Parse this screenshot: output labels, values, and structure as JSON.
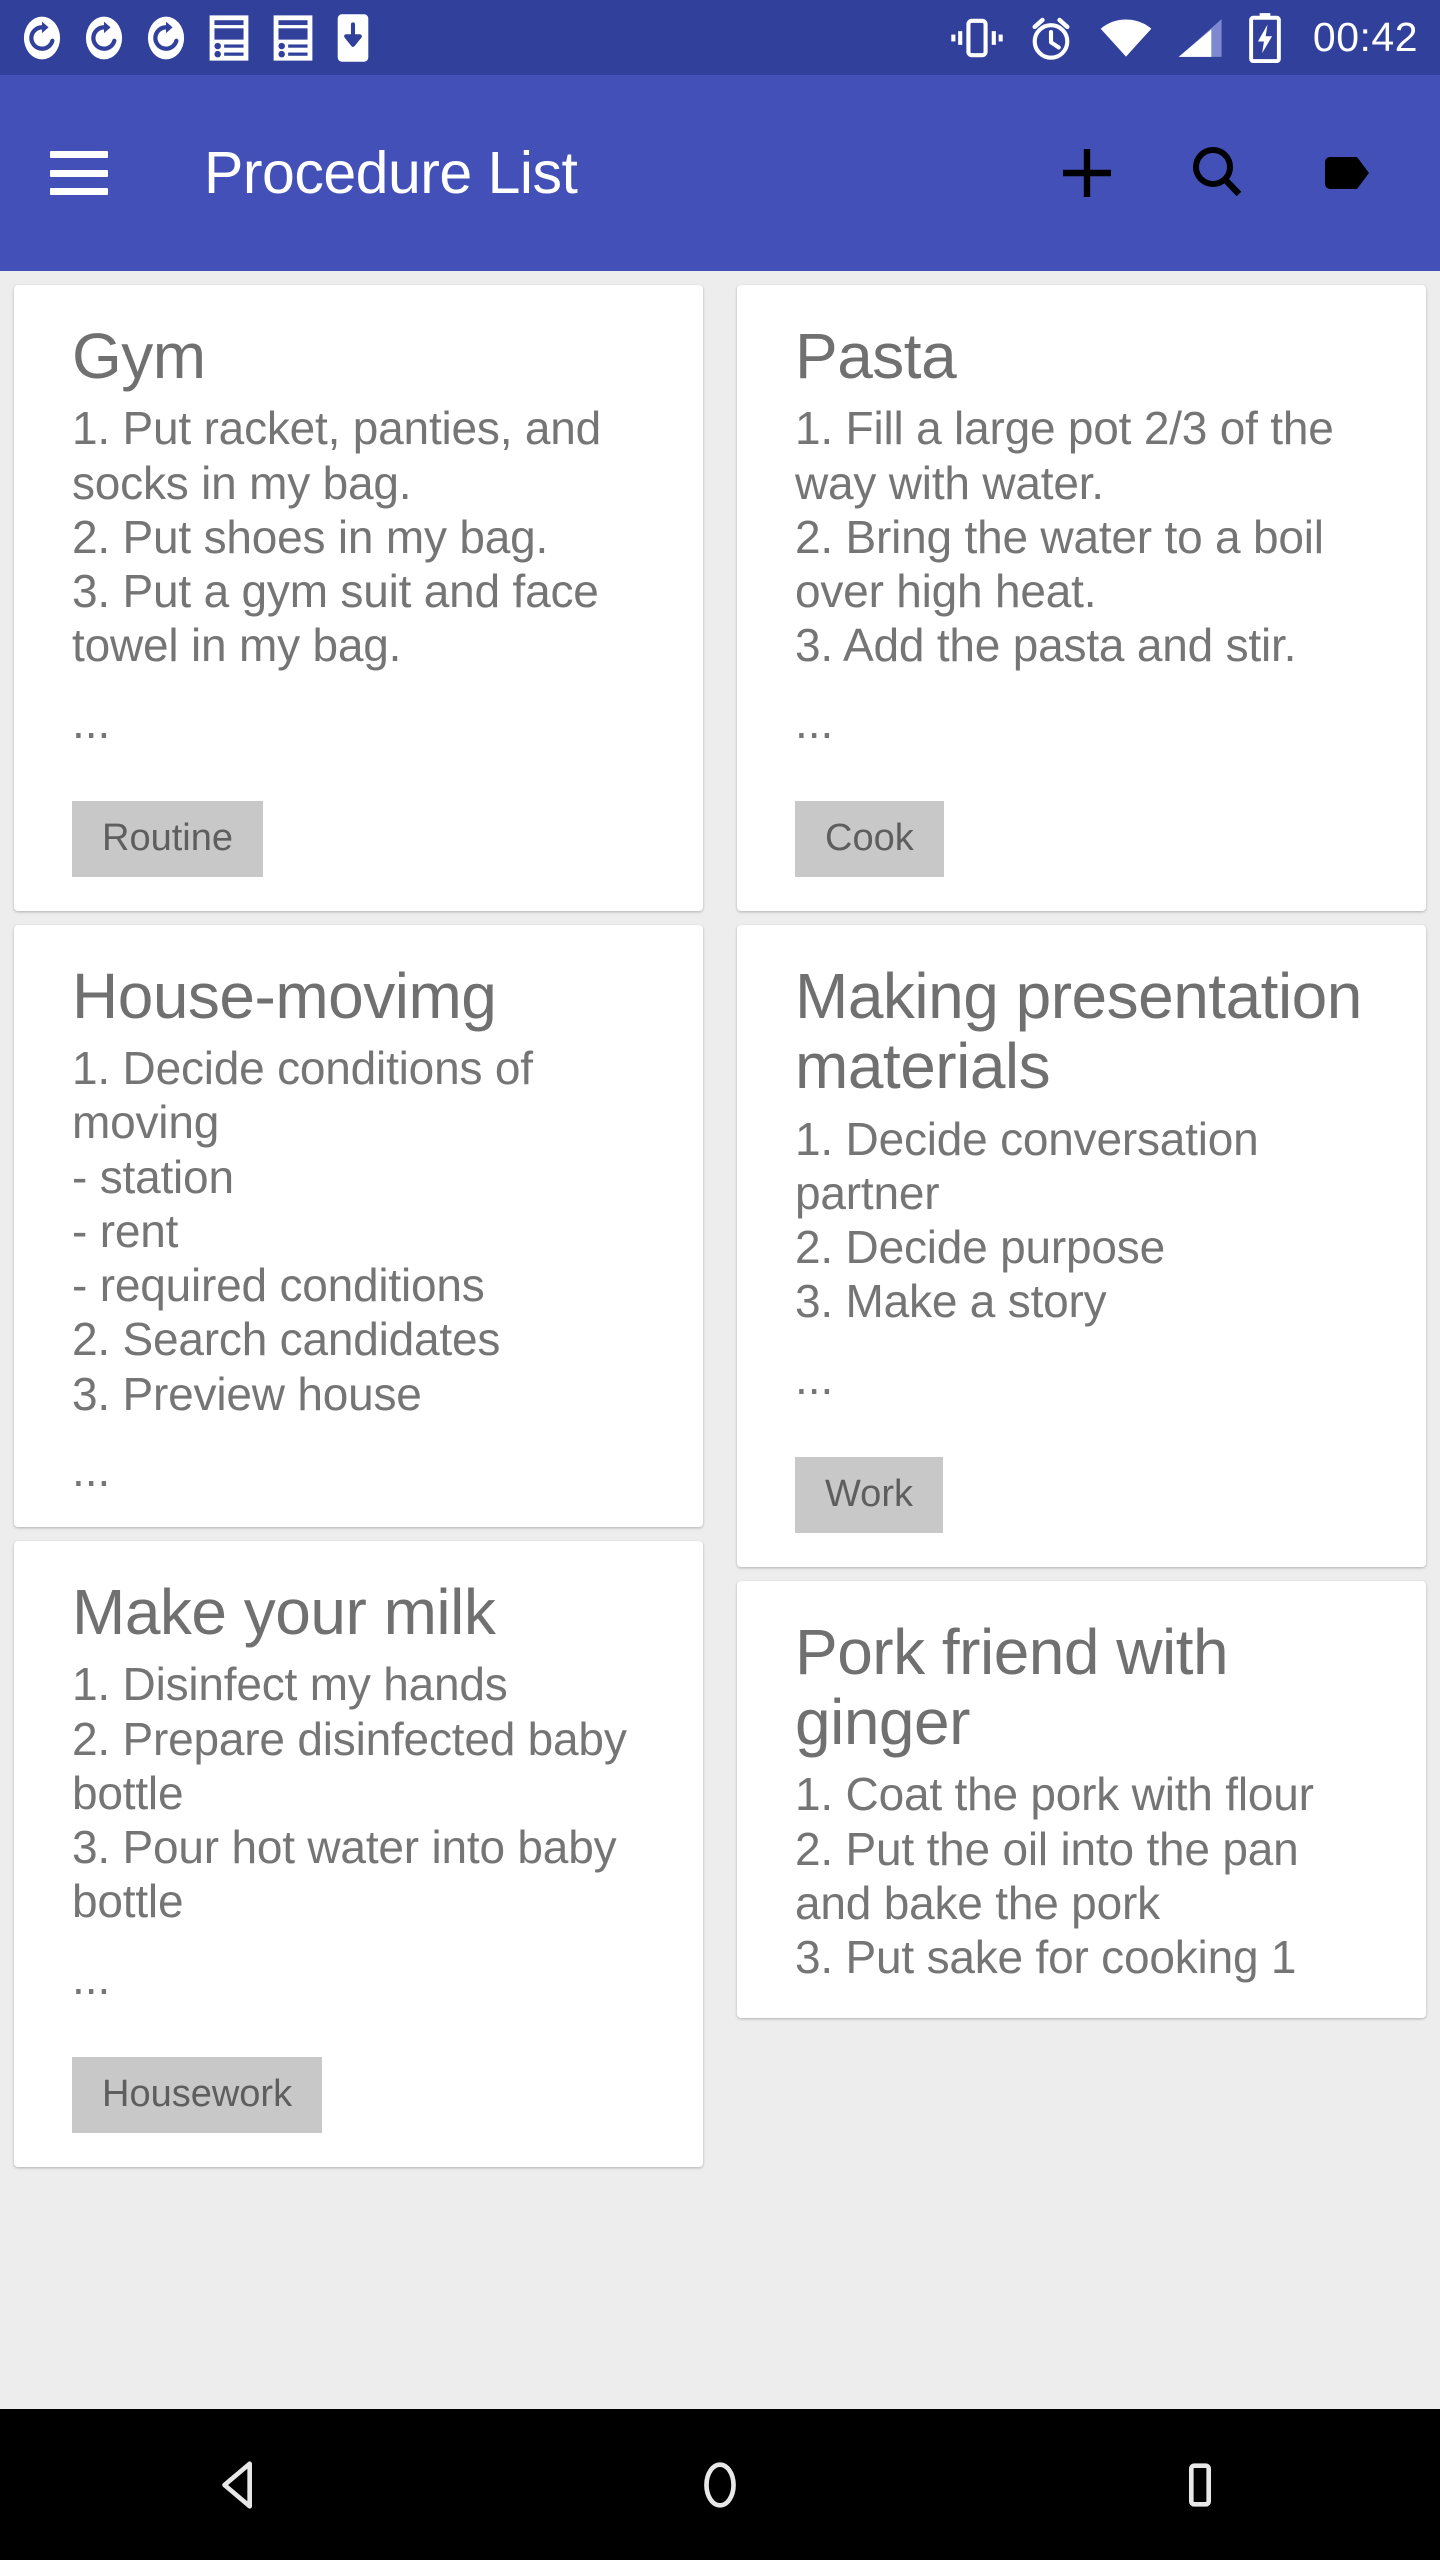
{
  "status_bar": {
    "time": "00:42",
    "bg_color": "#31409B",
    "icons": [
      "sync-icon",
      "sync-icon",
      "sync-icon",
      "article-icon",
      "article-icon",
      "download-to-device-icon"
    ],
    "right_icons": [
      "vibrate-icon",
      "alarm-clock-icon",
      "wifi-icon",
      "cell-signal-icon",
      "battery-charging-icon"
    ]
  },
  "app_bar": {
    "title": "Procedure List",
    "bg_color": "#4350B8",
    "menu_icon": "hamburger-menu-icon",
    "actions": [
      {
        "name": "add-icon",
        "label": "Add"
      },
      {
        "name": "search-icon",
        "label": "Search"
      },
      {
        "name": "tag-icon",
        "label": "Tag"
      }
    ]
  },
  "cards": {
    "left": [
      {
        "title": "Gym",
        "body": "1. Put racket, panties, and socks in my bag.\n2. Put shoes in my bag.\n3. Put a gym suit and face towel in my bag.",
        "ellipsis": "...",
        "tag": "Routine"
      },
      {
        "title": "House-movimg",
        "body": "1. Decide conditions of moving\n- station\n- rent\n- required conditions\n2. Search candidates\n3. Preview house",
        "ellipsis": "...",
        "tag": null
      },
      {
        "title": "Make your milk",
        "body": "1. Disinfect my hands\n2. Prepare disinfected baby bottle\n3. Pour hot water into baby bottle",
        "ellipsis": "...",
        "tag": "Housework"
      }
    ],
    "right": [
      {
        "title": "Pasta",
        "body": "1. Fill a large pot 2/3 of the way with water.\n2. Bring the water to a boil over high heat.\n3. Add the pasta and stir.",
        "ellipsis": "...",
        "tag": "Cook"
      },
      {
        "title": "Making presentation materials",
        "body": "1. Decide conversation partner\n2. Decide purpose\n3. Make a story",
        "ellipsis": "...",
        "tag": "Work"
      },
      {
        "title": "Pork friend with ginger",
        "body": "1. Coat the pork with flour\n2. Put the oil into the pan and bake the pork\n3. Put sake for cooking 1",
        "ellipsis": null,
        "tag": null
      }
    ]
  },
  "nav_bar": {
    "back": "back-triangle-icon",
    "home": "home-circle-icon",
    "recents": "recents-square-icon"
  },
  "colors": {
    "status_bar": "#31409B",
    "app_bar": "#4350B8",
    "page_bg": "#EDEDED",
    "card_bg": "#FFFFFF",
    "chip_bg": "#C8C8C8",
    "title_text": "#707070",
    "body_text": "#757575"
  }
}
